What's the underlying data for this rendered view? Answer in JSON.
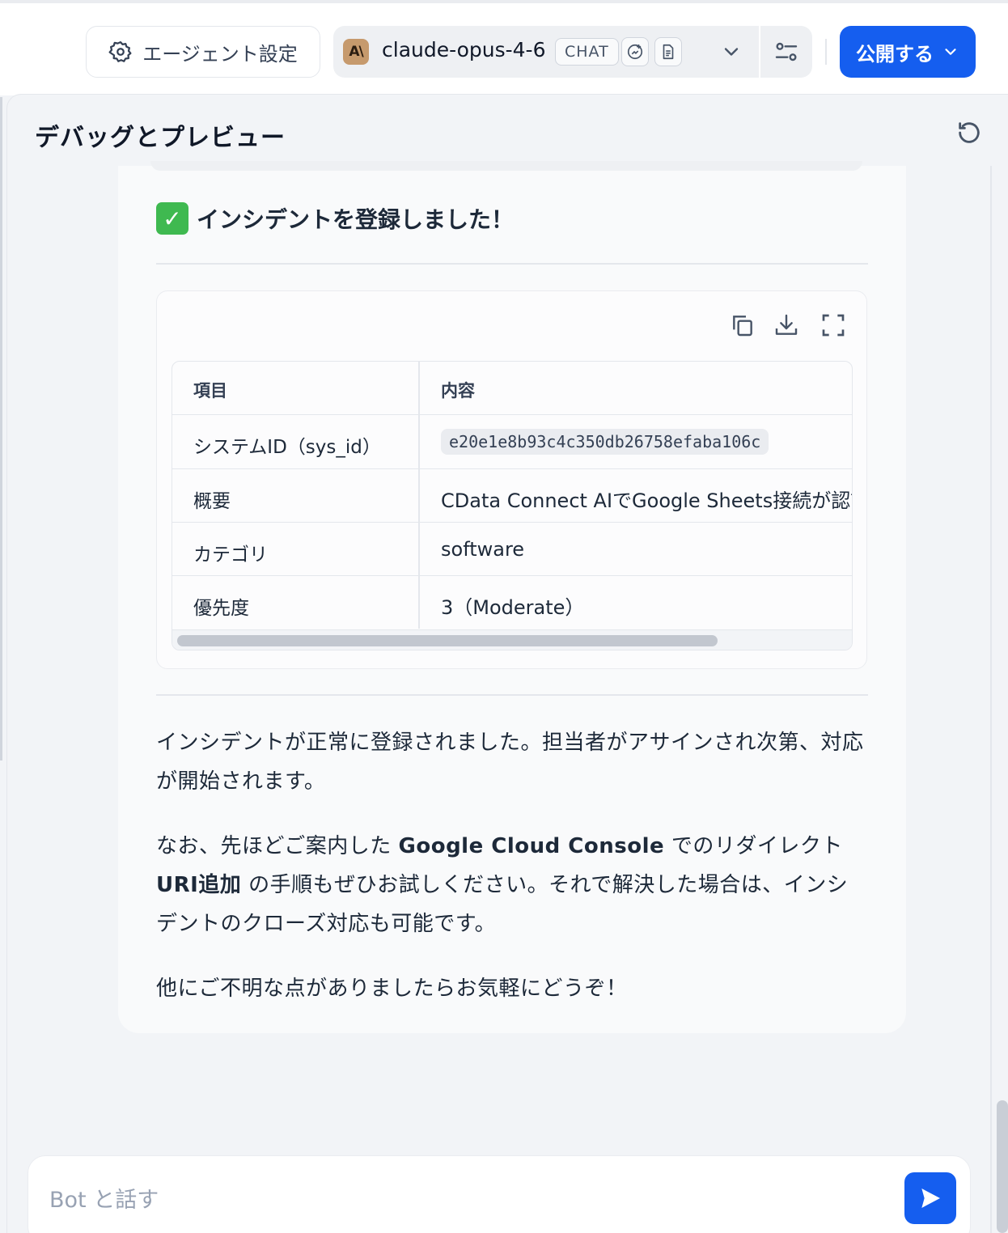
{
  "header": {
    "settings_label": "エージェント設定",
    "model": {
      "name": "claude-opus-4-6",
      "mode_badge": "CHAT",
      "logo_text": "A\\",
      "capabilities": [
        "vision-icon",
        "document-icon"
      ]
    },
    "publish_label": "公開する"
  },
  "panel": {
    "title": "デバッグとプレビュー"
  },
  "message": {
    "success_text": "インシデントを登録しました！",
    "success_emoji": "✓",
    "table": {
      "headers": [
        "項目",
        "内容"
      ],
      "rows": [
        {
          "label": "システムID（sys_id）",
          "value": "e20e1e8b93c4c350db26758efaba106c"
        },
        {
          "label": "概要",
          "value": "CData Connect AIでGoogle Sheets接続が認証エラーになる"
        },
        {
          "label": "カテゴリ",
          "value": "software"
        },
        {
          "label": "優先度",
          "value": "3（Moderate）"
        }
      ]
    },
    "para1": "インシデントが正常に登録されました。担当者がアサインされ次第、対応が開始されます。",
    "para2": {
      "prefix": "なお、先ほどご案内した ",
      "bold1": "Google Cloud Console",
      "mid": " でのリダイレクト",
      "bold2": "URI追加",
      "suffix": " の手順もぜひお試しください。それで解決した場合は、インシデントのクローズ対応も可能です。"
    },
    "para3": "他にご不明な点がありましたらお気軽にどうぞ！"
  },
  "input": {
    "placeholder": "Bot と話す",
    "value": ""
  },
  "colors": {
    "accent": "#155eef",
    "success": "#3fb950",
    "model_logo": "#c69a6d"
  }
}
